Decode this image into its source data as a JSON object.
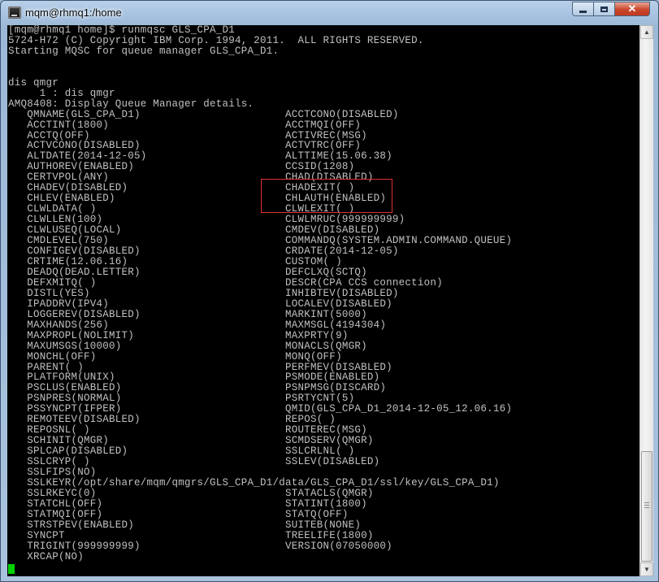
{
  "window": {
    "title": "mqm@rhmq1:/home",
    "icon": "terminal-icon",
    "controls": {
      "minimize": "minimize-icon",
      "maximize": "maximize-icon",
      "close": "close-icon"
    }
  },
  "colors": {
    "terminal_bg": "#000000",
    "terminal_fg": "#c0c0c0",
    "cursor": "#00d000",
    "highlight_box": "#e03030"
  },
  "terminal": {
    "header_lines": [
      "[mqm@rhmq1 home]$ runmqsc GLS_CPA_D1",
      "5724-H72 (C) Copyright IBM Corp. 1994, 2011.  ALL RIGHTS RESERVED.",
      "Starting MQSC for queue manager GLS_CPA_D1.",
      "",
      "",
      "dis qmgr",
      "     1 : dis qmgr",
      "AMQ8408: Display Queue Manager details."
    ],
    "attributes": [
      [
        "QMNAME(GLS_CPA_D1)",
        "ACCTCONO(DISABLED)"
      ],
      [
        "ACCTINT(1800)",
        "ACCTMQI(OFF)"
      ],
      [
        "ACCTQ(OFF)",
        "ACTIVREC(MSG)"
      ],
      [
        "ACTVCONO(DISABLED)",
        "ACTVTRC(OFF)"
      ],
      [
        "ALTDATE(2014-12-05)",
        "ALTTIME(15.06.38)"
      ],
      [
        "AUTHOREV(ENABLED)",
        "CCSID(1208)"
      ],
      [
        "CERTVPOL(ANY)",
        "CHAD(DISABLED)"
      ],
      [
        "CHADEV(DISABLED)",
        "CHADEXIT( )"
      ],
      [
        "CHLEV(ENABLED)",
        "CHLAUTH(ENABLED)"
      ],
      [
        "CLWLDATA( )",
        "CLWLEXIT( )"
      ],
      [
        "CLWLLEN(100)",
        "CLWLMRUC(999999999)"
      ],
      [
        "CLWLUSEQ(LOCAL)",
        "CMDEV(DISABLED)"
      ],
      [
        "CMDLEVEL(750)",
        "COMMANDQ(SYSTEM.ADMIN.COMMAND.QUEUE)"
      ],
      [
        "CONFIGEV(DISABLED)",
        "CRDATE(2014-12-05)"
      ],
      [
        "CRTIME(12.06.16)",
        "CUSTOM( )"
      ],
      [
        "DEADQ(DEAD.LETTER)",
        "DEFCLXQ(SCTQ)"
      ],
      [
        "DEFXMITQ( )",
        "DESCR(CPA CCS connection)"
      ],
      [
        "DISTL(YES)",
        "INHIBTEV(DISABLED)"
      ],
      [
        "IPADDRV(IPV4)",
        "LOCALEV(DISABLED)"
      ],
      [
        "LOGGEREV(DISABLED)",
        "MARKINT(5000)"
      ],
      [
        "MAXHANDS(256)",
        "MAXMSGL(4194304)"
      ],
      [
        "MAXPROPL(NOLIMIT)",
        "MAXPRTY(9)"
      ],
      [
        "MAXUMSGS(10000)",
        "MONACLS(QMGR)"
      ],
      [
        "MONCHL(OFF)",
        "MONQ(OFF)"
      ],
      [
        "PARENT( )",
        "PERFMEV(DISABLED)"
      ],
      [
        "PLATFORM(UNIX)",
        "PSMODE(ENABLED)"
      ],
      [
        "PSCLUS(ENABLED)",
        "PSNPMSG(DISCARD)"
      ],
      [
        "PSNPRES(NORMAL)",
        "PSRTYCNT(5)"
      ],
      [
        "PSSYNCPT(IFPER)",
        "QMID(GLS_CPA_D1_2014-12-05_12.06.16)"
      ],
      [
        "REMOTEEV(DISABLED)",
        "REPOS( )"
      ],
      [
        "REPOSNL( )",
        "ROUTEREC(MSG)"
      ],
      [
        "SCHINIT(QMGR)",
        "SCMDSERV(QMGR)"
      ],
      [
        "SPLCAP(DISABLED)",
        "SSLCRLNL( )"
      ],
      [
        "SSLCRYP( )",
        "SSLEV(DISABLED)"
      ],
      [
        "SSLFIPS(NO)",
        ""
      ],
      [
        "SSLKEYR(/opt/share/mqm/qmgrs/GLS_CPA_D1/data/GLS_CPA_D1/ssl/key/GLS_CPA_D1)",
        ""
      ],
      [
        "SSLRKEYC(0)",
        "STATACLS(QMGR)"
      ],
      [
        "STATCHL(OFF)",
        "STATINT(1800)"
      ],
      [
        "STATMQI(OFF)",
        "STATQ(OFF)"
      ],
      [
        "STRSTPEV(ENABLED)",
        "SUITEB(NONE)"
      ],
      [
        "SYNCPT",
        "TREELIFE(1800)"
      ],
      [
        "TRIGINT(999999999)",
        "VERSION(07050000)"
      ],
      [
        "XRCAP(NO)",
        ""
      ]
    ],
    "text": ""
  }
}
